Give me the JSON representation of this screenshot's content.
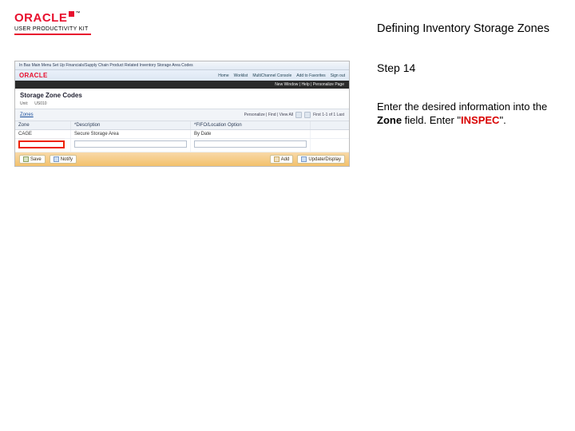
{
  "header": {
    "brand": "ORACLE",
    "product": "USER PRODUCTIVITY KIT",
    "page_title": "Defining Inventory Storage Zones"
  },
  "instructions": {
    "step": "Step 14",
    "line1a": "Enter the desired information into the ",
    "zone_bold": "Zone",
    "line1c": " field. Enter \"",
    "inspec": "INSPEC",
    "line1e": "\"."
  },
  "app": {
    "crumb": "In Bas     Main Menu     Set Up Financials/Supply Chain     Product Related     Inventory     Storage Area Codes",
    "menu": {
      "home": "Home",
      "worklist": "Worklist",
      "multich": "MultiChannel Console",
      "addfav": "Add to Favorites",
      "signout": "Sign out"
    },
    "blackstrip": "New Window | Help | Personalize Page",
    "section_title": "Storage Zone Codes",
    "unit_label": "Unit:",
    "unit_value": "US010",
    "zones_link": "Zones",
    "nav_text": "Personalize | Find | View All",
    "range": "First  1-1 of 1  Last",
    "cols": {
      "zone": "Zone",
      "desc": "*Description",
      "loc": "*FIFO/Location Option"
    },
    "row1": {
      "zone": "CAGE",
      "desc": "Secure Storage Area",
      "loc": "By Date"
    },
    "btns": {
      "save": "Save",
      "notify": "Notify",
      "add": "Add",
      "update": "Update/Display"
    }
  }
}
